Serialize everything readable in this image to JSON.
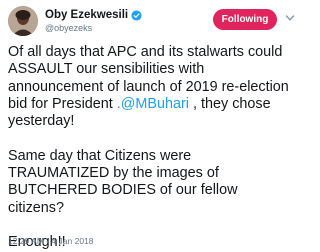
{
  "author": {
    "name": "Oby Ezekwesili",
    "handle": "@obyezeks",
    "verified": true
  },
  "follow_button": {
    "label": "Following",
    "color": "#e0245e"
  },
  "tweet": {
    "para1_before_mention": "Of all days that APC and its stalwarts could ASSAULT our sensibilities with announcement of launch of 2019 re-election bid for President ",
    "mention": ".@MBuhari",
    "para1_after_mention": " , they chose yesterday!",
    "para2": "Same day that Citizens were TRAUMATIZED by the images of BUTCHERED BODIES of our fellow citizens?",
    "para3": "Enough!!"
  },
  "timestamp": "12:29 AM - 4 Jan 2018",
  "colors": {
    "link": "#1da1f2",
    "text": "#14171a",
    "muted": "#657786",
    "verified_badge": "#1da1f2"
  },
  "icons": {
    "verified": "verified-badge-icon",
    "menu": "chevron-down-icon"
  }
}
